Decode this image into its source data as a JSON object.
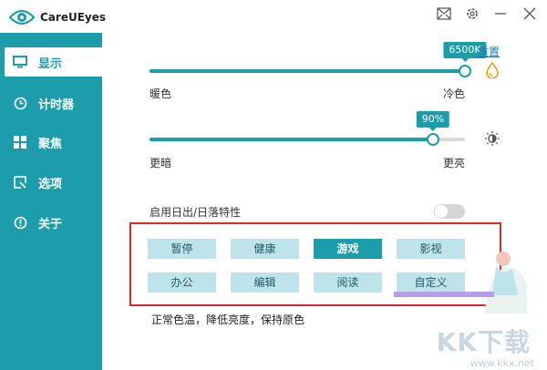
{
  "app": {
    "title": "CareUEyes"
  },
  "titlebar": {
    "icons": [
      "mail-icon",
      "gear-icon",
      "minimize-icon",
      "close-icon"
    ]
  },
  "sidebar": {
    "items": [
      {
        "label": "显示",
        "icon": "monitor-icon",
        "active": true
      },
      {
        "label": "计时器",
        "icon": "clock-icon",
        "active": false
      },
      {
        "label": "聚焦",
        "icon": "windows-icon",
        "active": false
      },
      {
        "label": "选项",
        "icon": "options-icon",
        "active": false
      },
      {
        "label": "关于",
        "icon": "info-icon",
        "active": false
      }
    ]
  },
  "color_temp": {
    "value_label": "6500K",
    "reset_label": "重置",
    "left_label": "暖色",
    "right_label": "冷色",
    "fraction": 1.0
  },
  "brightness": {
    "value_label": "90%",
    "left_label": "更暗",
    "right_label": "更亮",
    "fraction": 0.9
  },
  "sunrise": {
    "label": "启用日出/日落特性",
    "enabled": false
  },
  "modes": {
    "items": [
      "暂停",
      "健康",
      "游戏",
      "影视",
      "办公",
      "编辑",
      "阅读",
      "自定义"
    ],
    "active": "游戏"
  },
  "status_text": "正常色温，降低亮度，保持原色",
  "watermark": {
    "text": "KK下载",
    "url": "www.kkx.net"
  },
  "colors": {
    "accent": "#1d9dab",
    "highlight_box": "#e0262b",
    "mode_bg": "#bfe3ea"
  }
}
